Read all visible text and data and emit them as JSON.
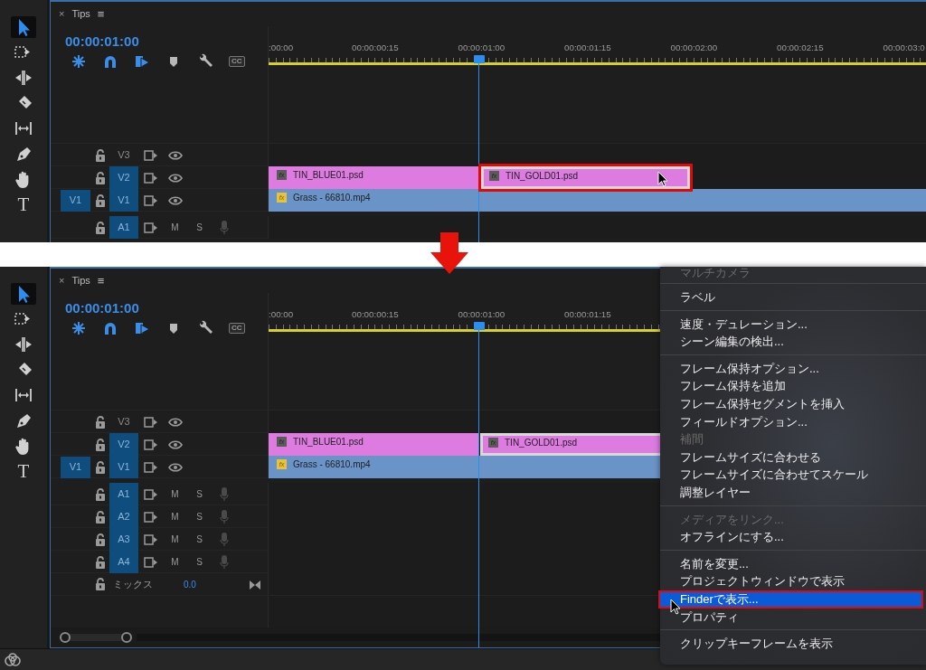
{
  "panels": [
    {
      "kind": "cropped",
      "tools": [
        {
          "kind": "selection",
          "selected": true
        },
        {
          "kind": "track-select",
          "selected": false
        },
        {
          "kind": "ripple",
          "selected": false
        },
        {
          "kind": "razor",
          "selected": false
        },
        {
          "kind": "slip",
          "selected": false
        },
        {
          "kind": "pen",
          "selected": false
        },
        {
          "kind": "hand",
          "selected": false
        },
        {
          "kind": "type",
          "selected": false,
          "glyph": "T"
        }
      ],
      "tab": {
        "close": "×",
        "title": "Tips",
        "menu": "≡"
      },
      "timecode": "00:00:01:00",
      "timeline_tools": [
        {
          "kind": "nest",
          "on": true
        },
        {
          "kind": "snap",
          "on": true
        },
        {
          "kind": "linked",
          "on": true
        },
        {
          "kind": "marker",
          "on": false
        },
        {
          "kind": "settings",
          "on": false
        },
        {
          "kind": "captions",
          "on": false,
          "label": "CC"
        }
      ],
      "ruler": [
        ":00:00",
        "00:00:00:15",
        "00:00:01:00",
        "00:00:01:15",
        "00:00:02:00",
        "00:00:02:15",
        "00:00:03:0"
      ],
      "tracks": [
        {
          "kind": "video",
          "name": "V3",
          "targeted": false
        },
        {
          "kind": "video",
          "name": "V2",
          "targeted": true,
          "clips": [
            {
              "name": "TIN_BLUE01.psd",
              "kind": "graphic",
              "badge": "fx",
              "effects": false,
              "selected": false,
              "highlighted": false
            },
            {
              "name": "TIN_GOLD01.psd",
              "kind": "graphic",
              "badge": "fx",
              "effects": false,
              "selected": true,
              "highlighted": true
            }
          ]
        },
        {
          "kind": "video",
          "source": "V1",
          "name": "V1",
          "targeted": true,
          "clips": [
            {
              "name": "Grass - 66810.mp4",
              "kind": "video",
              "badge": "fx",
              "effects": true,
              "selected": false,
              "highlighted": false
            }
          ]
        },
        {
          "kind": "audio",
          "name": "A1",
          "targeted": true,
          "mute": "M",
          "solo": "S"
        }
      ]
    },
    {
      "kind": "full",
      "tools": [
        {
          "kind": "selection",
          "selected": true
        },
        {
          "kind": "track-select",
          "selected": false
        },
        {
          "kind": "ripple",
          "selected": false
        },
        {
          "kind": "razor",
          "selected": false
        },
        {
          "kind": "slip",
          "selected": false
        },
        {
          "kind": "pen",
          "selected": false
        },
        {
          "kind": "hand",
          "selected": false
        },
        {
          "kind": "type",
          "selected": false,
          "glyph": "T"
        }
      ],
      "tab": {
        "close": "×",
        "title": "Tips",
        "menu": "≡"
      },
      "timecode": "00:00:01:00",
      "timeline_tools": [
        {
          "kind": "nest",
          "on": true
        },
        {
          "kind": "snap",
          "on": true
        },
        {
          "kind": "linked",
          "on": true
        },
        {
          "kind": "marker",
          "on": false
        },
        {
          "kind": "settings",
          "on": false
        },
        {
          "kind": "captions",
          "on": false,
          "label": "CC"
        }
      ],
      "ruler": [
        ":00:00",
        "00:00:00:15",
        "00:00:01:00",
        "00:00:01:15"
      ],
      "tracks": [
        {
          "kind": "video",
          "name": "V3",
          "targeted": false
        },
        {
          "kind": "video",
          "name": "V2",
          "targeted": true,
          "clips": [
            {
              "name": "TIN_BLUE01.psd",
              "kind": "graphic",
              "badge": "fx",
              "effects": false,
              "selected": false,
              "highlighted": false
            },
            {
              "name": "TIN_GOLD01.psd",
              "kind": "graphic",
              "badge": "fx",
              "effects": false,
              "selected": true,
              "highlighted": false
            }
          ]
        },
        {
          "kind": "video",
          "source": "V1",
          "name": "V1",
          "targeted": true,
          "clips": [
            {
              "name": "Grass - 66810.mp4",
              "kind": "video",
              "badge": "fx",
              "effects": true,
              "selected": false,
              "highlighted": false
            }
          ]
        },
        {
          "kind": "audio",
          "name": "A1",
          "targeted": true,
          "mute": "M",
          "solo": "S"
        },
        {
          "kind": "audio",
          "name": "A2",
          "targeted": true,
          "mute": "M",
          "solo": "S"
        },
        {
          "kind": "audio",
          "name": "A3",
          "targeted": true,
          "mute": "M",
          "solo": "S"
        },
        {
          "kind": "audio",
          "name": "A4",
          "targeted": true,
          "mute": "M",
          "solo": "S"
        },
        {
          "kind": "mix",
          "name": "ミックス",
          "value": "0.0"
        }
      ]
    }
  ],
  "context_menu": {
    "groups": [
      {
        "items": [
          {
            "label": "マルチカメラ",
            "disabled": true,
            "selected": false
          }
        ]
      },
      {
        "items": [
          {
            "label": "ラベル",
            "disabled": false,
            "selected": false
          }
        ]
      },
      {
        "items": [
          {
            "label": "速度・デュレーション...",
            "disabled": false,
            "selected": false
          },
          {
            "label": "シーン編集の検出...",
            "disabled": false,
            "selected": false
          }
        ]
      },
      {
        "items": [
          {
            "label": "フレーム保持オプション...",
            "disabled": false,
            "selected": false
          },
          {
            "label": "フレーム保持を追加",
            "disabled": false,
            "selected": false
          },
          {
            "label": "フレーム保持セグメントを挿入",
            "disabled": false,
            "selected": false
          },
          {
            "label": "フィールドオプション...",
            "disabled": false,
            "selected": false
          },
          {
            "label": "補間",
            "disabled": true,
            "selected": false
          },
          {
            "label": "フレームサイズに合わせる",
            "disabled": false,
            "selected": false
          },
          {
            "label": "フレームサイズに合わせてスケール",
            "disabled": false,
            "selected": false
          },
          {
            "label": "調整レイヤー",
            "disabled": false,
            "selected": false
          }
        ]
      },
      {
        "items": [
          {
            "label": "メディアをリンク...",
            "disabled": true,
            "selected": false
          },
          {
            "label": "オフラインにする...",
            "disabled": false,
            "selected": false
          }
        ]
      },
      {
        "items": [
          {
            "label": "名前を変更...",
            "disabled": false,
            "selected": false
          },
          {
            "label": "プロジェクトウィンドウで表示",
            "disabled": false,
            "selected": false
          },
          {
            "label": "Finderで表示...",
            "disabled": false,
            "selected": true,
            "highlighted": true
          },
          {
            "label": "プロパティ",
            "disabled": false,
            "selected": false
          }
        ]
      },
      {
        "items": [
          {
            "label": "クリップキーフレームを表示",
            "disabled": false,
            "selected": false
          }
        ]
      }
    ]
  }
}
